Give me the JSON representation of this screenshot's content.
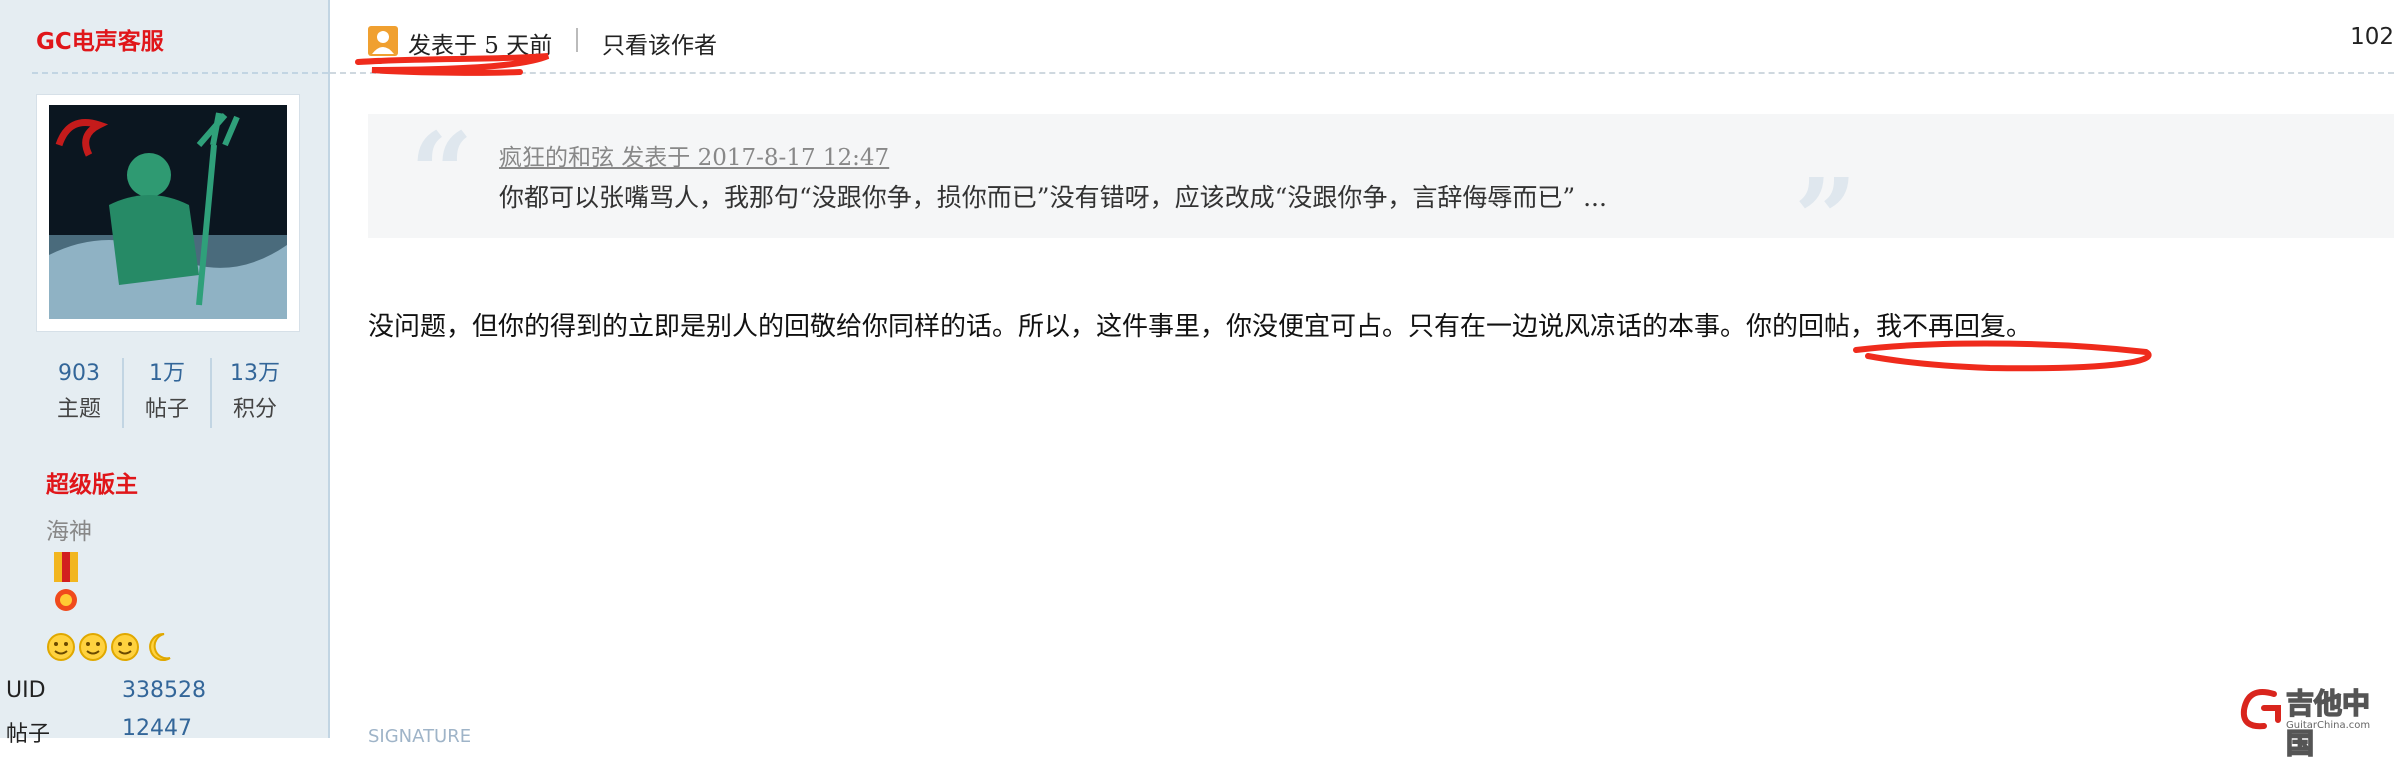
{
  "user": {
    "name": "GC电声客服",
    "stats": [
      {
        "value": "903",
        "label": "主题"
      },
      {
        "value": "1万",
        "label": "帖子"
      },
      {
        "value": "13万",
        "label": "积分"
      }
    ],
    "group": "超级版主",
    "custom_title": "海神",
    "info": [
      {
        "key": "UID",
        "value": "338528"
      },
      {
        "key": "帖子",
        "value": "12447"
      }
    ]
  },
  "post": {
    "posted": "发表于 5 天前",
    "author_only": "只看该作者",
    "floor": "102",
    "quote": {
      "meta": "疯狂的和弦 发表于 2017-8-17 12:47",
      "text": "你都可以张嘴骂人，我那句“没跟你争，损你而已”没有错呀，应该改成“没跟你争，言辞侮辱而已” ..."
    },
    "reply": "没问题，但你的得到的立即是别人的回敬给你同样的话。所以，这件事里，你没便宜可占。只有在一边说风凉话的本事。你的回帖，我不再回复。",
    "signature_label": "SIGNATURE"
  },
  "watermark": {
    "text": "吉他中国",
    "sub": "GuitarChina.com"
  },
  "colors": {
    "accent_red": "#e0161a",
    "link_blue": "#336699",
    "sidebar_bg": "#e5edf2",
    "markup_red": "#ef2b1c"
  },
  "icons": [
    "user-icon",
    "medal-icon",
    "rank-face-icon",
    "moon-icon",
    "quote-open-icon",
    "quote-close-icon",
    "site-logo-icon"
  ]
}
